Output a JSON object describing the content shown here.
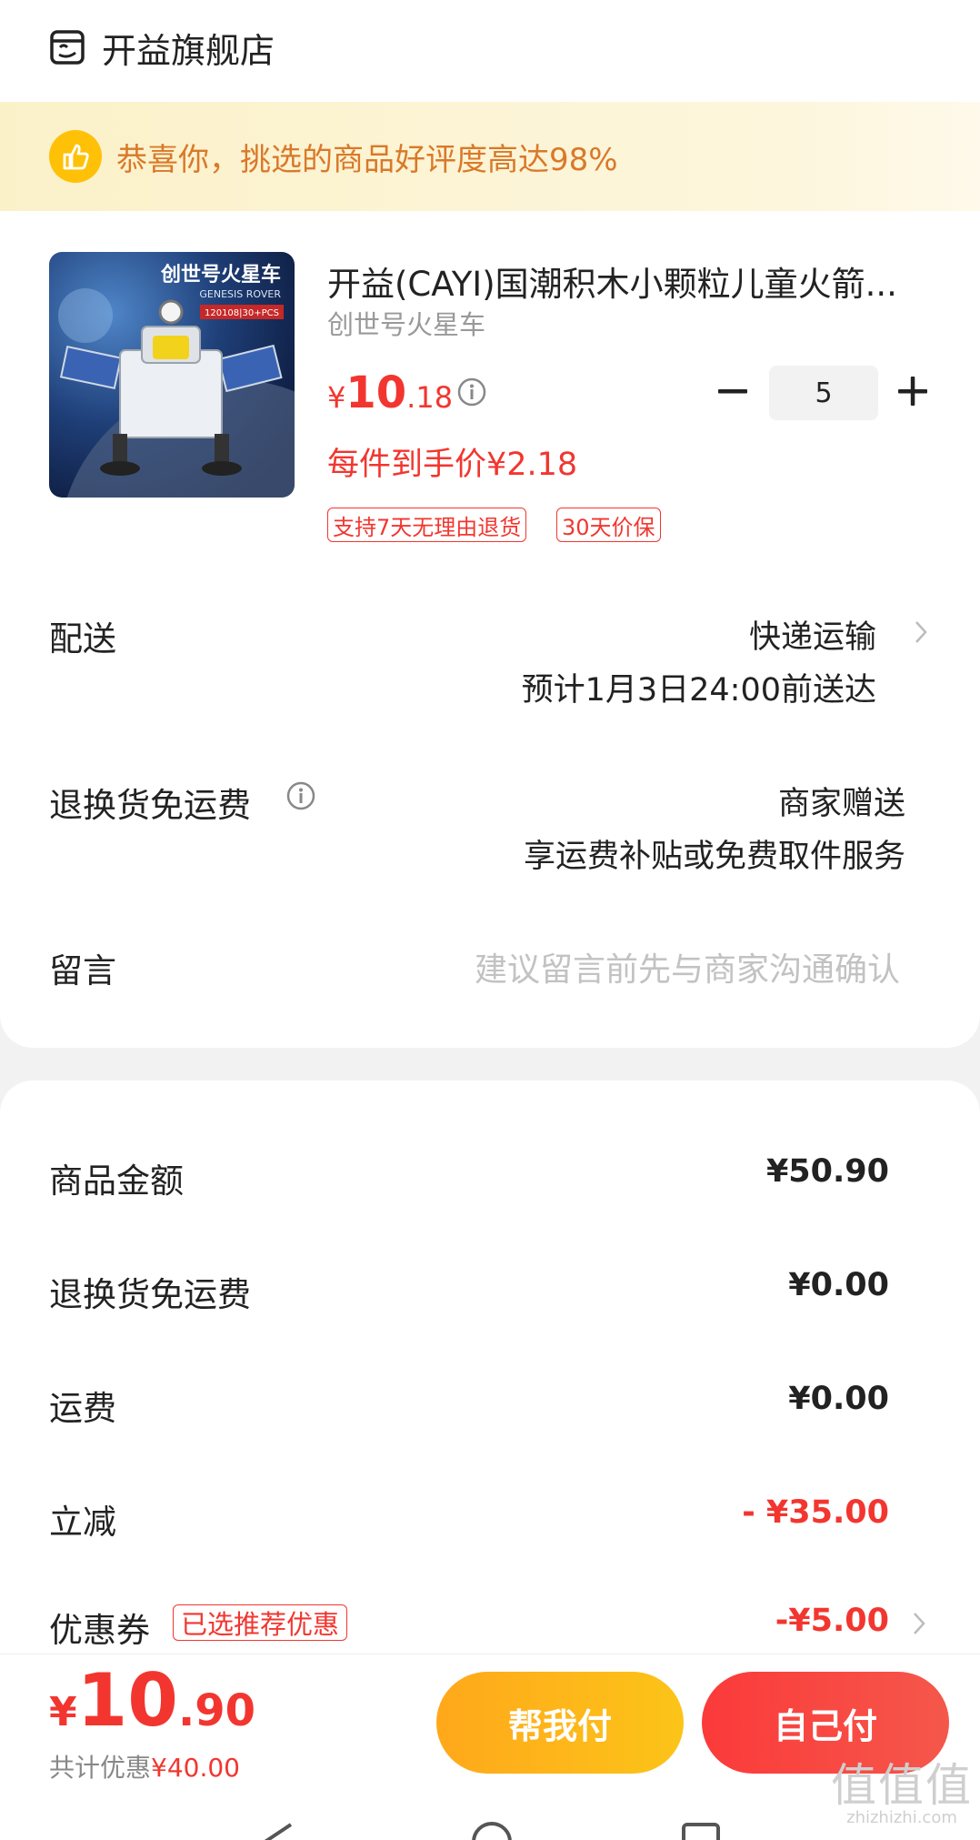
{
  "shop": {
    "name": "开益旗舰店",
    "icon": "store-face-icon"
  },
  "banner": {
    "text": "恭喜你，挑选的商品好评度高达98%",
    "icon": "thumbs-up-icon"
  },
  "product": {
    "image_text_1": "创世号火星车",
    "image_text_2": "GENESIS ROVER",
    "image_text_3": "120108|30+PCS",
    "title": "开益(CAYI)国潮积木小颗粒儿童火箭...",
    "spec": "创世号火星车",
    "price_symbol": "¥",
    "price_int": "10",
    "price_dec": ".18",
    "unit_price": "每件到手价¥2.18",
    "tags": [
      "支持7天无理由退货",
      "30天价保"
    ],
    "quantity": "5"
  },
  "delivery": {
    "label": "配送",
    "method": "快递运输",
    "eta": "预计1月3日24:00前送达"
  },
  "return_shipping": {
    "label": "退换货免运费",
    "value1": "商家赠送",
    "value2": "享运费补贴或免费取件服务"
  },
  "note": {
    "label": "留言",
    "placeholder": "建议留言前先与商家沟通确认"
  },
  "summary": {
    "items": [
      {
        "label": "商品金额",
        "value": "¥50.90"
      },
      {
        "label": "退换货免运费",
        "value": "¥0.00"
      },
      {
        "label": "运费",
        "value": "¥0.00"
      },
      {
        "label": "立减",
        "value": "- ¥35.00"
      }
    ],
    "coupon": {
      "label": "优惠券",
      "tag": "已选推荐优惠",
      "value": "-¥5.00"
    }
  },
  "footer": {
    "total_symbol": "¥",
    "total_int": "10",
    "total_dec": ".90",
    "discount_label": "共计优惠",
    "discount_value": "¥40.00",
    "btn_help": "帮我付",
    "btn_self": "自己付"
  },
  "watermark": {
    "line1": "值值值",
    "line2": "zhizhizhi.com"
  },
  "colors": {
    "accent_red": "#f2362f",
    "banner_orange": "#d9792a",
    "yellow": "#ffc107"
  }
}
